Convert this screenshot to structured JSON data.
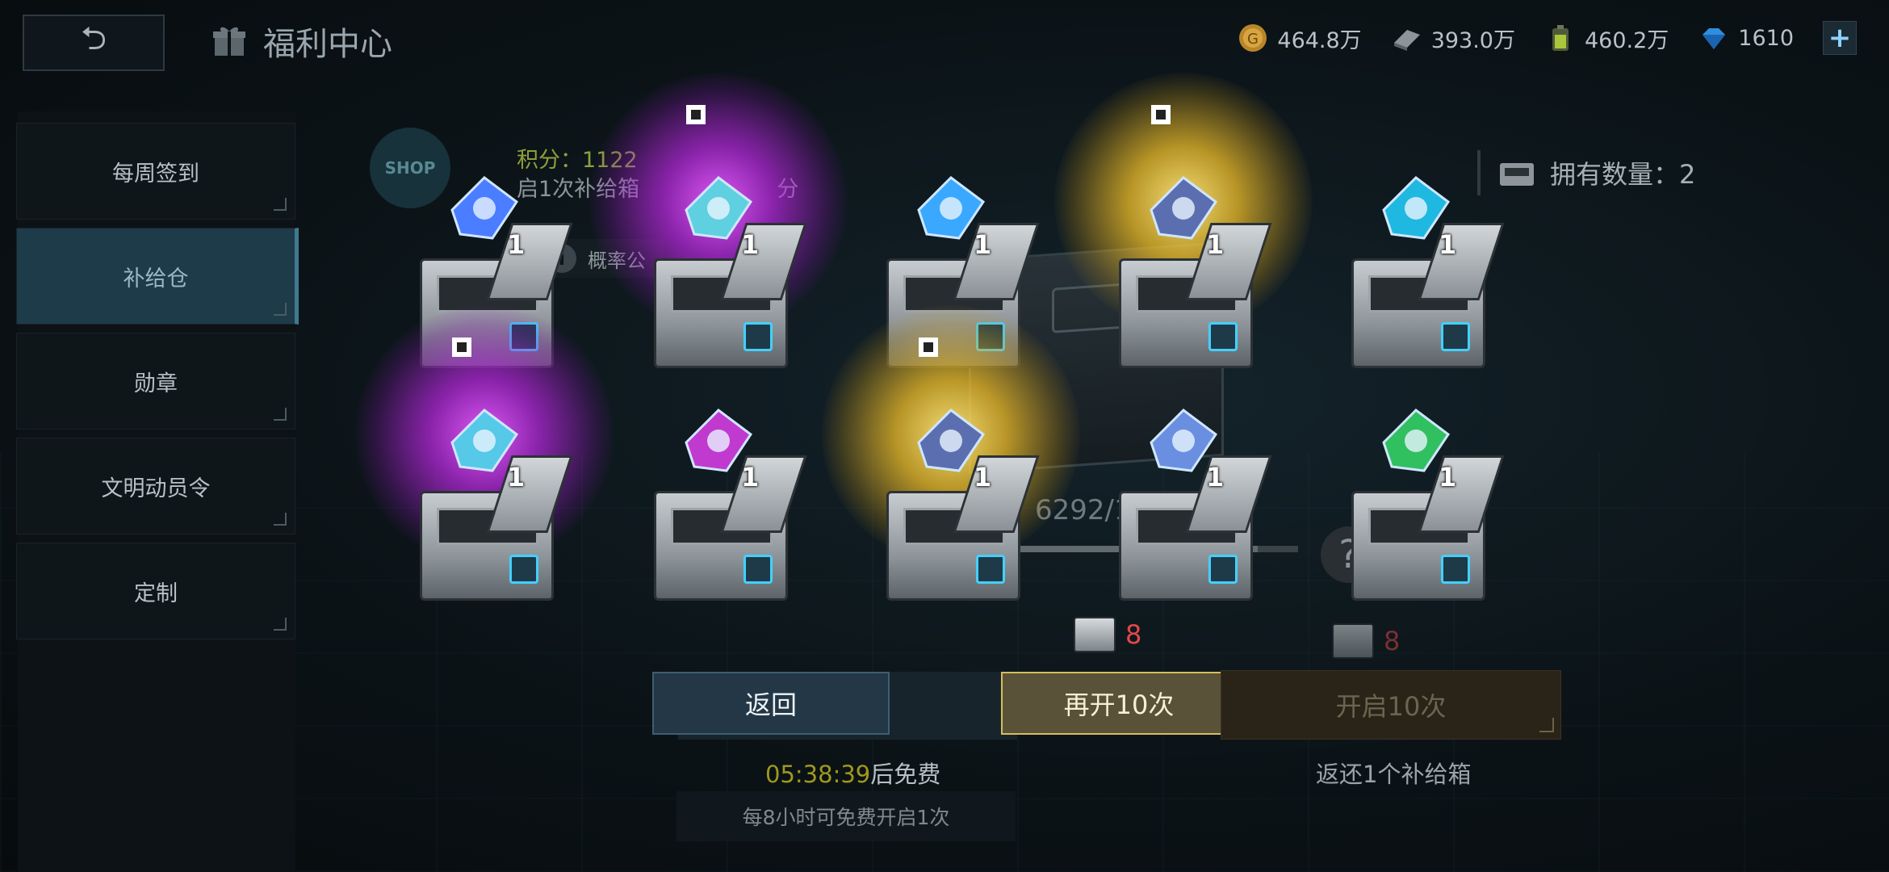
{
  "header": {
    "back_icon": "return-arrow-icon",
    "title": "福利中心",
    "title_icon": "gift-icon"
  },
  "resources": [
    {
      "name": "gold",
      "icon": "gold-coin-icon",
      "value": "464.8万"
    },
    {
      "name": "alloy",
      "icon": "metal-bar-icon",
      "value": "393.0万"
    },
    {
      "name": "energy",
      "icon": "energy-cell-icon",
      "value": "460.2万"
    },
    {
      "name": "diamond",
      "icon": "diamond-icon",
      "value": "1610"
    }
  ],
  "sidebar": {
    "items": [
      {
        "label": "每周签到",
        "active": false
      },
      {
        "label": "补给仓",
        "active": true
      },
      {
        "label": "勋章",
        "active": false
      },
      {
        "label": "文明动员令",
        "active": false
      },
      {
        "label": "定制",
        "active": false
      }
    ]
  },
  "panel": {
    "shop_label": "SHOP",
    "points_text": "积分：1122",
    "hint_text": "启1次补给箱",
    "hint_suffix": "分",
    "probability_label": "概率公",
    "owned_label": "拥有数量：2",
    "progress_text": "6292/1",
    "progress_fraction": 0.9
  },
  "rewards": [
    {
      "item": "blue-mecha-core",
      "rarity": "normal",
      "count": "1"
    },
    {
      "item": "purple-battleship",
      "rarity": "purple",
      "count": "1"
    },
    {
      "item": "blue-energy-orb",
      "rarity": "normal",
      "count": "1"
    },
    {
      "item": "gold-turret-module",
      "rarity": "gold",
      "count": "1"
    },
    {
      "item": "blue-blueprint-card",
      "rarity": "normal",
      "count": "1"
    },
    {
      "item": "purple-fighter",
      "rarity": "purple",
      "count": "1"
    },
    {
      "item": "exp-chip",
      "rarity": "normal",
      "count": "1"
    },
    {
      "item": "gold-turret-module",
      "rarity": "gold",
      "count": "1"
    },
    {
      "item": "blue-drone",
      "rarity": "normal",
      "count": "1"
    },
    {
      "item": "green-gear-card",
      "rarity": "normal",
      "count": "1"
    }
  ],
  "actions": {
    "back_label": "返回",
    "again_label": "再开10次",
    "open_label": "开启10次",
    "again_cost": "8",
    "open_cost": "8",
    "timer_value": "05:38:39",
    "timer_suffix": "后免费",
    "free_note": "每8小时可免费开启1次",
    "refund_note": "返还1个补给箱"
  },
  "colors": {
    "purple_glow": "#d04cff",
    "gold_glow": "#f0c030",
    "cost_red": "#e24848",
    "timer_yellow": "#a0981c"
  }
}
